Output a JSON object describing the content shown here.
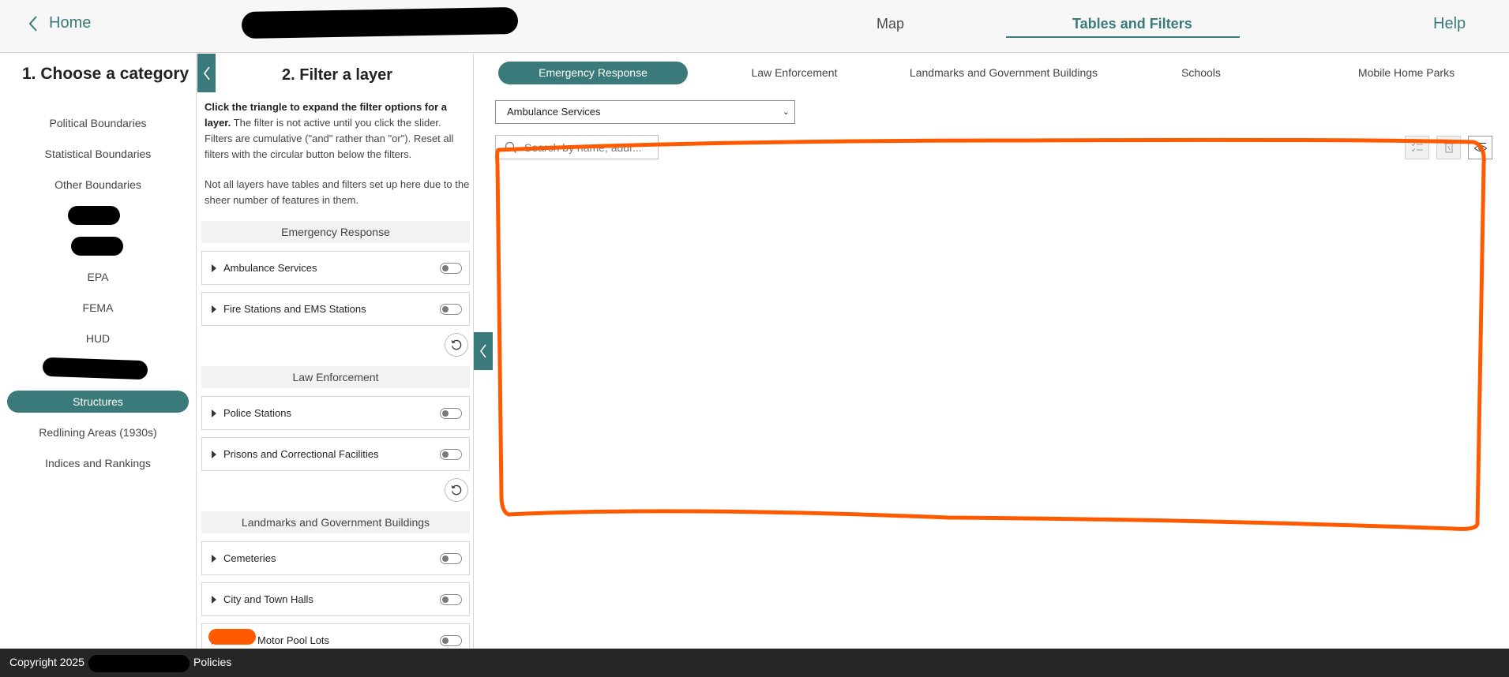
{
  "header": {
    "home_label": "Home",
    "nav": {
      "map": "Map",
      "tables_filters": "Tables and Filters",
      "help": "Help"
    }
  },
  "left": {
    "title": "1. Choose a category",
    "categories": {
      "political": "Political Boundaries",
      "statistical": "Statistical Boundaries",
      "other": "Other Boundaries",
      "epa": "EPA",
      "fema": "FEMA",
      "hud": "HUD",
      "structures": "Structures",
      "redlining": "Redlining Areas (1930s)",
      "indices": "Indices and Rankings"
    },
    "active_category": "Structures"
  },
  "middle": {
    "title": "2. Filter a layer",
    "instructions_bold": "Click the triangle to expand the filter options for a layer.",
    "instructions_rest": " The filter is not active until you click the slider. Filters are cumulative (\"and\" rather than \"or\"). Reset all filters with the circular button below the filters.",
    "note": "Not all layers have tables and filters set up here due to the sheer number of features in them.",
    "groups": [
      {
        "name": "Emergency Response",
        "layers": [
          "Ambulance Services",
          "Fire Stations and EMS Stations"
        ]
      },
      {
        "name": "Law Enforcement",
        "layers": [
          "Police Stations",
          "Prisons and Correctional Facilities"
        ]
      },
      {
        "name": "Landmarks and Government Buildings",
        "layers": [
          "Cemeteries",
          "City and Town Halls",
          "Motor Pool Lots"
        ]
      }
    ]
  },
  "right": {
    "tabs": [
      "Emergency Response",
      "Law Enforcement",
      "Landmarks and Government Buildings",
      "Schools",
      "Mobile Home Parks"
    ],
    "active_tab": "Emergency Response",
    "selected_layer": "Ambulance Services",
    "search_placeholder": "Search by name, addr..."
  },
  "footer": {
    "copyright": "Copyright 2025",
    "policies": "Policies"
  },
  "colors": {
    "accent": "#3b7a7a",
    "annotation": "#ff5a00",
    "footer_bg": "#262626"
  },
  "icons": [
    "chevron-left-icon",
    "search-icon",
    "select-all-icon",
    "trash-icon",
    "eye-icon",
    "reset-icon",
    "triangle-right-icon"
  ]
}
